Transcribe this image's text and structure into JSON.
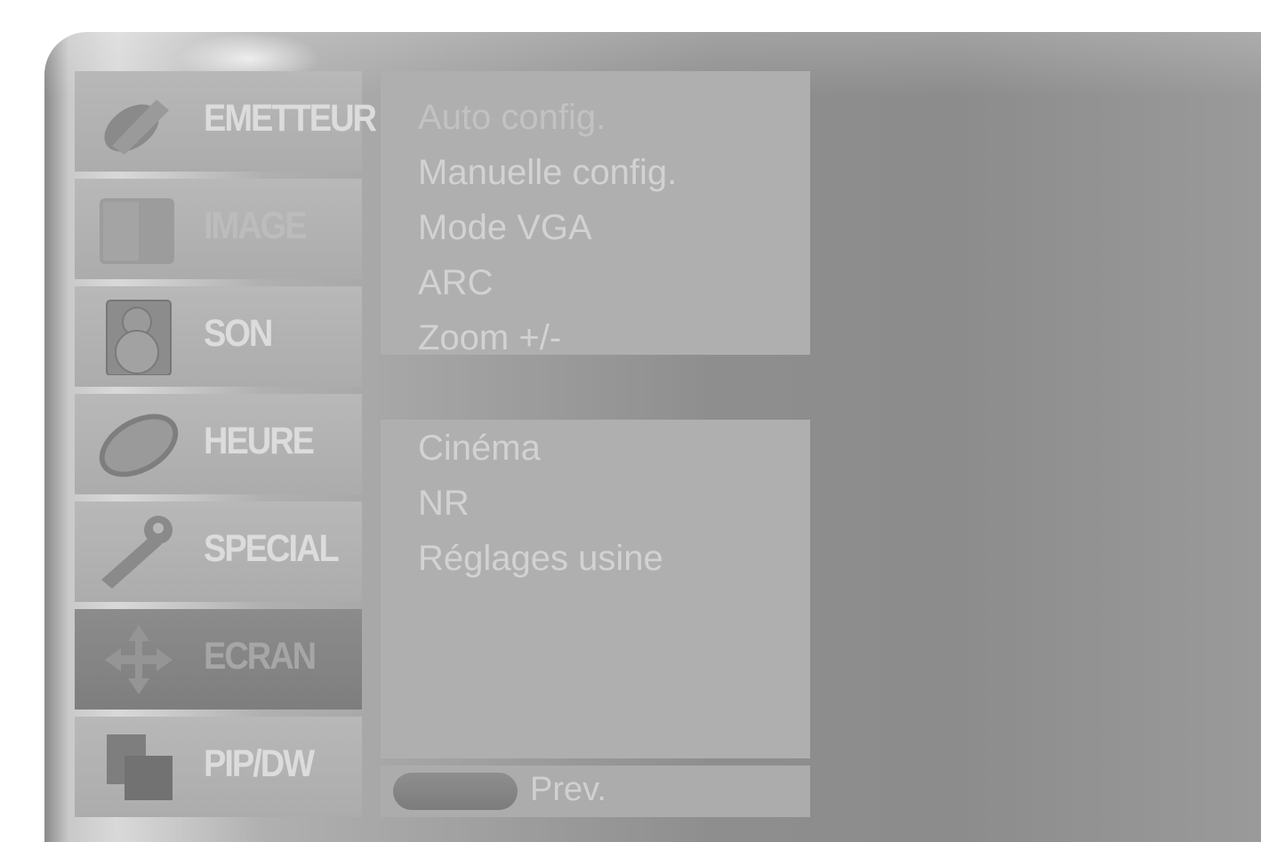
{
  "menu": {
    "items": [
      {
        "label": "EMETTEUR",
        "icon": "satellite-dish-icon"
      },
      {
        "label": "IMAGE",
        "icon": "picture-icon"
      },
      {
        "label": "SON",
        "icon": "speaker-icon"
      },
      {
        "label": "HEURE",
        "icon": "clock-icon"
      },
      {
        "label": "SPECIAL",
        "icon": "key-icon"
      },
      {
        "label": "ECRAN",
        "icon": "move-arrows-icon",
        "selected": true
      },
      {
        "label": "PIP/DW",
        "icon": "pip-icon"
      }
    ]
  },
  "options_top": [
    "Auto config.",
    "Manuelle config.",
    "Mode VGA",
    "ARC",
    "Zoom +/-"
  ],
  "options_bottom": [
    "Cinéma",
    "NR",
    "Réglages usine"
  ],
  "footer": {
    "prev_label": "Prev."
  },
  "colors": {
    "background": "#8e8e8e",
    "panel": "#afafaf",
    "selected": "#828282",
    "text": "#d2d2d2"
  }
}
